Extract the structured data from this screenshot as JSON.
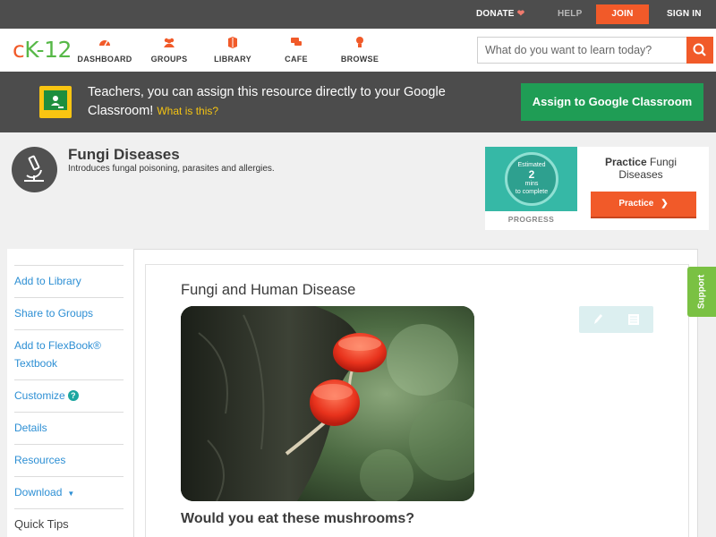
{
  "topbar": {
    "donate": "DONATE",
    "help": "HELP",
    "join": "JOIN",
    "signin": "SIGN IN"
  },
  "logo": {
    "text_c": "c",
    "text_k": "K",
    "text_dash": "-",
    "text_12": "12"
  },
  "nav": {
    "items": [
      {
        "label": "DASHBOARD",
        "icon": "dashboard-icon"
      },
      {
        "label": "GROUPS",
        "icon": "groups-icon"
      },
      {
        "label": "LIBRARY",
        "icon": "library-icon"
      },
      {
        "label": "CAFE",
        "icon": "cafe-icon"
      },
      {
        "label": "BROWSE",
        "icon": "browse-icon"
      }
    ]
  },
  "search": {
    "placeholder": "What do you want to learn today?"
  },
  "banner": {
    "text": "Teachers, you can assign this resource directly to your Google Classroom!",
    "link": "What is this?",
    "button": "Assign to Google Classroom"
  },
  "concept": {
    "title": "Fungi Diseases",
    "description": "Introduces fungal poisoning, parasites and allergies."
  },
  "practice": {
    "estimated_line1": "Estimated",
    "estimated_value": "2",
    "estimated_line2": "mins",
    "estimated_line3": "to complete",
    "progress_label": "PROGRESS",
    "heading_bold": "Practice",
    "heading_rest": "Fungi Diseases",
    "button": "Practice"
  },
  "sidebar": {
    "items": [
      {
        "label": "Add to Library"
      },
      {
        "label": "Share to Groups"
      },
      {
        "label": "Add to FlexBook® Textbook"
      },
      {
        "label": "Customize"
      },
      {
        "label": "Details"
      },
      {
        "label": "Resources"
      },
      {
        "label": "Download"
      },
      {
        "label": "Quick Tips"
      }
    ]
  },
  "content": {
    "title": "Fungi and Human Disease",
    "question": "Would you eat these mushrooms?"
  },
  "support": {
    "label": "Support"
  },
  "colors": {
    "accent": "#f15a29",
    "green": "#1f9d55",
    "link": "#2d8fd4"
  }
}
